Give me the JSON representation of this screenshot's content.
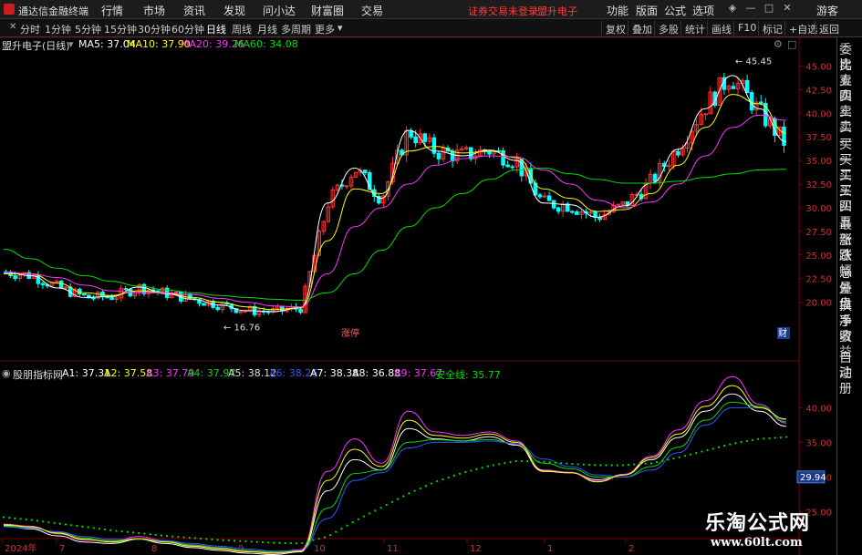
{
  "app": {
    "name": "通达信金融终端",
    "warning": "证券交易未登录",
    "stock_tag": "盟升电子",
    "guest": "游客"
  },
  "menu": [
    "行情",
    "市场",
    "资讯",
    "发现",
    "问小达",
    "财富圈",
    "交易"
  ],
  "menu_right": [
    "功能",
    "版面",
    "公式",
    "选项"
  ],
  "toolbar": {
    "periods": [
      "分时",
      "1分钟",
      "5分钟",
      "15分钟",
      "30分钟",
      "60分钟",
      "日线",
      "周线",
      "月线",
      "多周期",
      "更多"
    ],
    "active_period": "日线",
    "right": [
      "复权",
      "叠加",
      "多股",
      "统计",
      "画线",
      "F10",
      "标记",
      "+自选",
      "返回"
    ]
  },
  "main_legend": {
    "title": "盟升电子(日线)",
    "items": [
      {
        "label": "MA5: 37.04",
        "color": "#ffffff"
      },
      {
        "label": "MA10: 37.90",
        "color": "#ffff00"
      },
      {
        "label": "MA20: 39.26",
        "color": "#ff33ff"
      },
      {
        "label": "MA60: 34.08",
        "color": "#00dd00"
      }
    ]
  },
  "indicator_legend": {
    "title": "股朋指标网",
    "items": [
      {
        "label": "A1: 37.31",
        "color": "#ffffff"
      },
      {
        "label": "A2: 37.58",
        "color": "#ffff00"
      },
      {
        "label": "A3: 37.79",
        "color": "#ff33ff"
      },
      {
        "label": "A4: 37.97",
        "color": "#00dd00"
      },
      {
        "label": "A5: 38.12",
        "color": "#dddddd"
      },
      {
        "label": "A6: 38.26",
        "color": "#3355ff"
      },
      {
        "label": "A7: 38.38",
        "color": "#ffffff"
      },
      {
        "label": "A8: 36.88",
        "color": "#ffffff"
      },
      {
        "label": "A9: 37.67",
        "color": "#ff33ff"
      },
      {
        "label": "安全线: 35.77",
        "color": "#00dd00"
      }
    ]
  },
  "annotations": {
    "high": "45.45",
    "low": "16.76",
    "zt": "涨停",
    "cai": "财",
    "current_value": "29.94"
  },
  "right_panel": [
    "委比",
    "卖五",
    "卖四",
    "卖三",
    "卖二",
    "卖一",
    "买一",
    "买二",
    "买三",
    "买四",
    "买五",
    "最新",
    "涨跌",
    "涨幅",
    "总量",
    "外盘",
    "换手",
    "净资",
    "收益",
    "自动",
    "注册"
  ],
  "watermark": {
    "line1": "乐淘公式网",
    "line2": "www.60lt.com"
  },
  "colors": {
    "up": "#ff3333",
    "down": "#00ffff",
    "ma5": "#ffffff",
    "ma10": "#ffff00",
    "ma20": "#ff33ff",
    "ma60": "#00dd00"
  },
  "chart_data": [
    {
      "type": "line",
      "title": "盟升电子(日线)",
      "xlabel": "",
      "ylabel": "",
      "ylim": [
        16.0,
        46.5
      ],
      "x": [
        "2024年",
        "7",
        "8",
        "9",
        "10",
        "11",
        "12",
        "1",
        "2"
      ],
      "yticks": [
        "20.00",
        "22.50",
        "25.00",
        "27.50",
        "30.00",
        "32.50",
        "35.00",
        "37.50",
        "40.00",
        "42.50",
        "45.00"
      ],
      "series": [
        {
          "name": "MA5",
          "values": [
            23.2,
            22.8,
            21.5,
            20.5,
            20.6,
            21.6,
            20.9,
            20.3,
            19.7,
            19.1,
            19.0,
            19.4,
            30.5,
            34.2,
            31.0,
            38.2,
            36.0,
            35.5,
            36.1,
            35.0,
            30.5,
            30.3,
            29.0,
            30.2,
            32.6,
            36.2,
            40.5,
            44.0,
            40.5,
            37.0
          ]
        },
        {
          "name": "MA10",
          "values": [
            23.0,
            23.0,
            22.0,
            21.0,
            20.7,
            21.2,
            21.0,
            20.5,
            20.0,
            19.5,
            19.2,
            19.4,
            26.5,
            32.0,
            31.5,
            36.0,
            36.5,
            35.8,
            36.0,
            35.3,
            32.0,
            31.0,
            29.6,
            29.8,
            31.5,
            34.5,
            38.5,
            42.0,
            41.0,
            37.9
          ]
        },
        {
          "name": "MA20",
          "values": [
            23.2,
            23.0,
            22.6,
            21.8,
            21.2,
            21.0,
            21.0,
            20.8,
            20.4,
            20.0,
            19.6,
            19.5,
            23.0,
            28.0,
            30.0,
            32.5,
            34.5,
            35.2,
            35.5,
            35.4,
            34.0,
            32.5,
            30.8,
            30.0,
            30.6,
            32.5,
            35.5,
            38.5,
            39.8,
            39.26
          ]
        },
        {
          "name": "MA60",
          "values": [
            25.6,
            24.6,
            23.6,
            22.8,
            22.2,
            21.7,
            21.3,
            21.0,
            20.7,
            20.5,
            20.3,
            20.2,
            21.0,
            23.0,
            25.5,
            28.0,
            30.0,
            31.5,
            33.0,
            34.0,
            34.2,
            33.6,
            33.0,
            32.6,
            32.6,
            32.8,
            33.2,
            33.6,
            34.0,
            34.08
          ]
        }
      ]
    },
    {
      "type": "line",
      "title": "股朋指标网",
      "xlabel": "",
      "ylabel": "",
      "ylim": [
        24.0,
        44.0
      ],
      "yticks": [
        "25.00",
        "30.00",
        "35.00",
        "40.00"
      ],
      "series": [
        {
          "name": "A1",
          "values": [
            23.0,
            22.5,
            21.5,
            20.6,
            20.4,
            21.0,
            20.4,
            19.8,
            19.4,
            19.0,
            18.8,
            19.2,
            28.0,
            32.5,
            31.0,
            37.0,
            35.5,
            35.2,
            35.8,
            34.6,
            30.8,
            30.6,
            29.6,
            30.3,
            32.5,
            35.7,
            39.5,
            42.0,
            39.5,
            37.31
          ]
        },
        {
          "name": "A3",
          "values": [
            23.2,
            22.9,
            21.8,
            20.9,
            20.7,
            21.4,
            20.8,
            20.1,
            19.7,
            19.3,
            19.1,
            19.5,
            30.8,
            35.5,
            32.0,
            39.5,
            36.5,
            36.0,
            36.5,
            35.2,
            31.0,
            30.7,
            29.4,
            30.4,
            33.0,
            36.8,
            41.0,
            44.5,
            40.5,
            37.79
          ]
        },
        {
          "name": "A4",
          "values": [
            22.9,
            22.7,
            22.0,
            21.2,
            20.8,
            21.0,
            20.7,
            20.2,
            19.8,
            19.4,
            19.2,
            19.4,
            25.5,
            30.5,
            31.0,
            35.0,
            35.4,
            35.2,
            35.4,
            34.8,
            32.0,
            31.2,
            30.0,
            30.0,
            31.5,
            34.3,
            38.2,
            40.8,
            40.2,
            37.97
          ]
        },
        {
          "name": "A6",
          "values": [
            22.8,
            22.6,
            22.1,
            21.4,
            21.0,
            21.0,
            20.8,
            20.4,
            20.0,
            19.6,
            19.3,
            19.4,
            24.0,
            29.5,
            30.6,
            34.2,
            35.0,
            35.0,
            35.2,
            34.8,
            32.6,
            31.5,
            30.3,
            30.0,
            31.0,
            33.5,
            37.5,
            40.0,
            40.0,
            38.26
          ]
        },
        {
          "name": "A7",
          "values": [
            23.1,
            22.8,
            21.9,
            21.0,
            20.6,
            21.1,
            20.6,
            20.0,
            19.6,
            19.2,
            19.0,
            19.3,
            29.5,
            34.0,
            31.5,
            38.2,
            36.0,
            35.6,
            36.2,
            35.0,
            30.9,
            30.6,
            29.3,
            30.3,
            32.8,
            36.2,
            40.2,
            43.2,
            40.0,
            38.38
          ]
        },
        {
          "name": "安全线",
          "values": [
            24.2,
            23.8,
            23.3,
            22.8,
            22.3,
            21.9,
            21.5,
            21.2,
            20.9,
            20.7,
            20.5,
            20.4,
            21.4,
            23.6,
            25.6,
            27.6,
            29.3,
            30.6,
            31.6,
            32.3,
            32.2,
            31.9,
            31.7,
            31.7,
            32.0,
            32.8,
            33.8,
            34.8,
            35.5,
            35.77
          ]
        }
      ]
    }
  ]
}
